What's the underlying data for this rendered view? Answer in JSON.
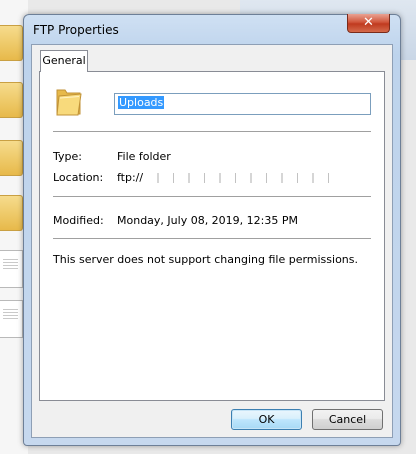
{
  "window": {
    "title": "FTP Properties",
    "close_glyph": "✕"
  },
  "tabs": [
    {
      "label": "General",
      "selected": true
    }
  ],
  "general": {
    "folder_icon": "folder-icon",
    "name_value": "Uploads",
    "type_label": "Type:",
    "type_value": "File folder",
    "location_label": "Location:",
    "location_value": "ftp://",
    "modified_label": "Modified:",
    "modified_value": "Monday, July 08, 2019, 12:35 PM",
    "note": "This server does not support changing file permissions."
  },
  "buttons": {
    "ok": "OK",
    "cancel": "Cancel"
  },
  "colors": {
    "selection": "#3399ff",
    "close_button": "#c84a2d",
    "title_bar": "#c6d8ee"
  }
}
